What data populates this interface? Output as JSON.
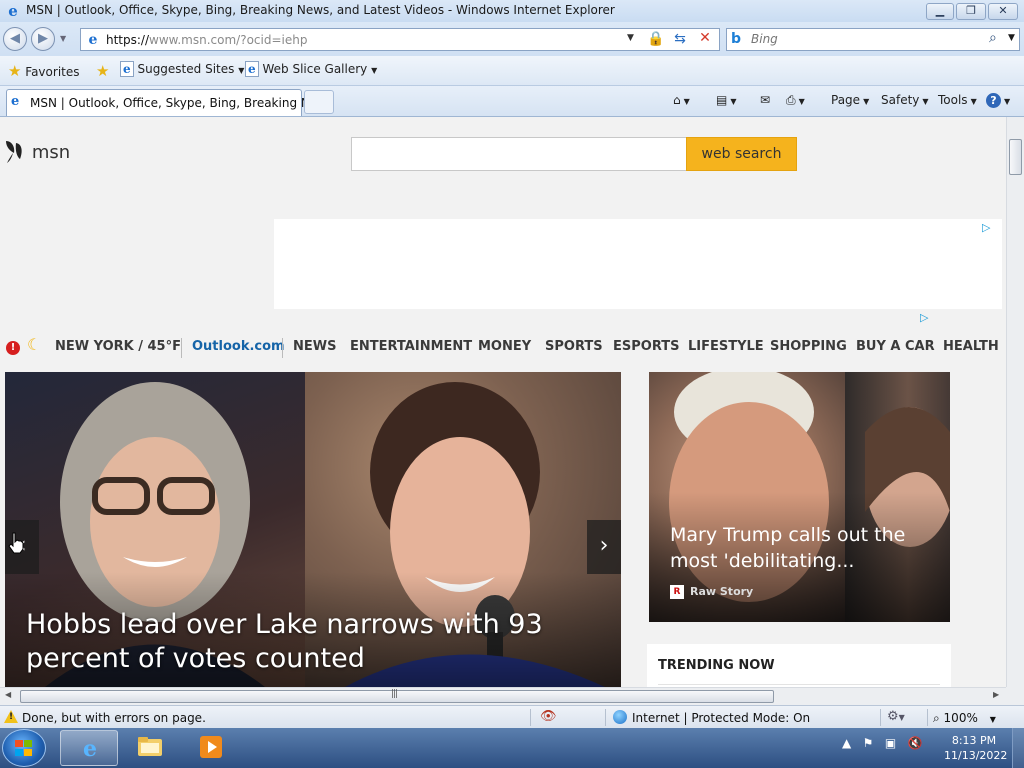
{
  "window": {
    "title": "MSN | Outlook, Office, Skype, Bing, Breaking News, and Latest Videos - Windows Internet Explorer",
    "min_glyph": "▁",
    "max_glyph": "❐",
    "close_glyph": "✕"
  },
  "address": {
    "url_prefix": "https://",
    "url_rest": "www.msn.com/?ocid=iehp"
  },
  "search": {
    "placeholder": "Bing"
  },
  "favorites_bar": {
    "favorites_label": "Favorites",
    "suggested_sites": "Suggested Sites",
    "web_slice_gallery": "Web Slice Gallery"
  },
  "tabs": [
    {
      "label": "MSN | Outlook, Office, Skype, Bing, Breaking Ne..."
    }
  ],
  "command_bar": {
    "page": "Page",
    "safety": "Safety",
    "tools": "Tools"
  },
  "page": {
    "logo_text": "msn",
    "search_button": "web search",
    "ad_choice": "▷",
    "nav": {
      "weather": "NEW YORK / 45°F",
      "links": [
        "Outlook.com",
        "NEWS",
        "ENTERTAINMENT",
        "MONEY",
        "SPORTS",
        "ESPORTS",
        "LIFESTYLE",
        "SHOPPING",
        "BUY A CAR",
        "HEALTH"
      ]
    },
    "hero": {
      "headline": "Hobbs lead over Lake narrows with 93 percent of votes counted"
    },
    "side_card": {
      "title": "Mary Trump calls out the most 'debilitating...",
      "source": "Raw Story"
    },
    "trending_label": "TRENDING NOW"
  },
  "status_bar": {
    "message": "Done, but with errors on page.",
    "zone": "Internet | Protected Mode: On",
    "zoom": "100%"
  },
  "taskbar": {
    "time": "8:13 PM",
    "date": "11/13/2022"
  },
  "colors": {
    "search_button": "#f5b31d",
    "outlook_link": "#1564a8",
    "alert": "#d61f1f"
  }
}
